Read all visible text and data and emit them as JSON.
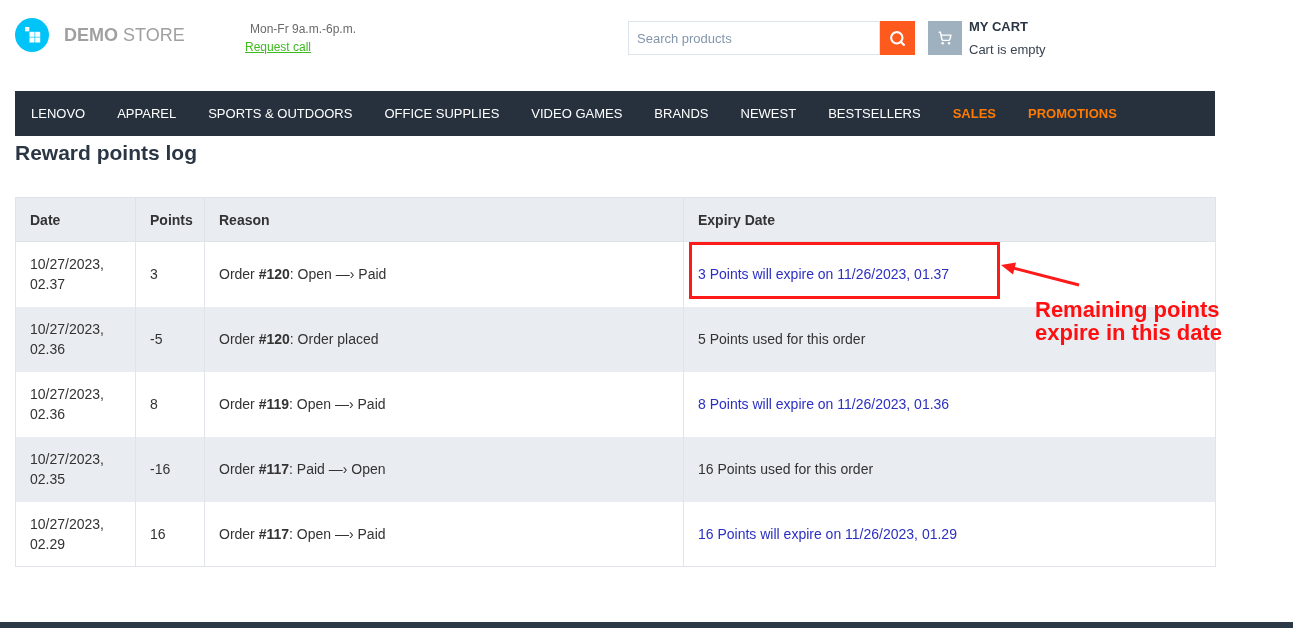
{
  "header": {
    "store_name": "**DEMO** STORE",
    "hours": "Mon-Fr 9a.m.-6p.m.",
    "request_call": "Request call",
    "search": {
      "placeholder": "Search products"
    },
    "cart": {
      "title": "MY CART",
      "status": "Cart is empty"
    }
  },
  "nav": [
    {
      "label": "LENOVO",
      "accent": false
    },
    {
      "label": "APPAREL",
      "accent": false
    },
    {
      "label": "SPORTS & OUTDOORS",
      "accent": false
    },
    {
      "label": "OFFICE SUPPLIES",
      "accent": false
    },
    {
      "label": "VIDEO GAMES",
      "accent": false
    },
    {
      "label": "BRANDS",
      "accent": false
    },
    {
      "label": "NEWEST",
      "accent": false
    },
    {
      "label": "BESTSELLERS",
      "accent": false
    },
    {
      "label": "SALES",
      "accent": true
    },
    {
      "label": "PROMOTIONS",
      "accent": true
    }
  ],
  "page_title": "Reward points log",
  "table": {
    "columns": [
      "Date",
      "Points",
      "Reason",
      "Expiry Date"
    ],
    "rows": [
      {
        "date": "10/27/2023, 02.37",
        "points": "3",
        "reason": "Order **#120**: Open —› Paid",
        "expiry": {
          "kind": "expiry",
          "text": "3 Points will expire on 11/26/2023, 01.37"
        },
        "highlighted": true
      },
      {
        "date": "10/27/2023, 02.36",
        "points": "-5",
        "reason": "Order **#120**: Order placed",
        "expiry": {
          "kind": "used",
          "text": "5 Points used for this order"
        },
        "highlighted": false
      },
      {
        "date": "10/27/2023, 02.36",
        "points": "8",
        "reason": "Order **#119**: Open —› Paid",
        "expiry": {
          "kind": "expiry",
          "text": "8 Points will expire on 11/26/2023, 01.36"
        },
        "highlighted": false
      },
      {
        "date": "10/27/2023, 02.35",
        "points": "-16",
        "reason": "Order **#117**: Paid —› Open",
        "expiry": {
          "kind": "used",
          "text": "16 Points used for this order"
        },
        "highlighted": false
      },
      {
        "date": "10/27/2023, 02.29",
        "points": "16",
        "reason": "Order **#117**: Open —› Paid",
        "expiry": {
          "kind": "expiry",
          "text": "16 Points will expire on 11/26/2023, 01.29"
        },
        "highlighted": false
      }
    ]
  },
  "annotation": {
    "text": "Remaining points expire in this date"
  }
}
